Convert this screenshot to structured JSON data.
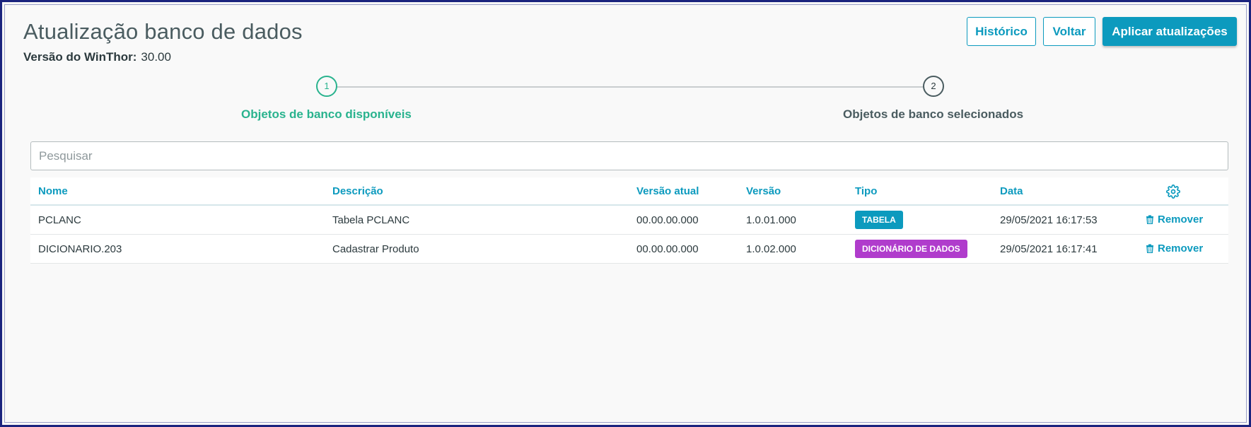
{
  "header": {
    "title": "Atualização banco de dados",
    "version_label": "Versão do WinThor:",
    "version_value": "30.00"
  },
  "toolbar": {
    "historico_label": "Histórico",
    "voltar_label": "Voltar",
    "aplicar_label": "Aplicar atualizações"
  },
  "stepper": {
    "steps": [
      {
        "number": "1",
        "label": "Objetos de banco disponíveis",
        "active": true
      },
      {
        "number": "2",
        "label": "Objetos de banco selecionados",
        "active": false
      }
    ]
  },
  "search": {
    "placeholder": "Pesquisar",
    "value": ""
  },
  "table": {
    "columns": {
      "nome": "Nome",
      "descricao": "Descrição",
      "versao_atual": "Versão atual",
      "versao": "Versão",
      "tipo": "Tipo",
      "data": "Data"
    },
    "settings_icon": "gear-icon",
    "rows": [
      {
        "nome": "PCLANC",
        "descricao": "Tabela PCLANC",
        "versao_atual": "00.00.00.000",
        "versao": "1.0.01.000",
        "tipo": "TABELA",
        "tipo_color": "#0c9abe",
        "data": "29/05/2021 16:17:53",
        "acao": "Remover",
        "acao_icon": "trash-icon"
      },
      {
        "nome": "DICIONARIO.203",
        "descricao": "Cadastrar Produto",
        "versao_atual": "00.00.00.000",
        "versao": "1.0.02.000",
        "tipo": "DICIONÁRIO DE DADOS",
        "tipo_color": "#b03ccc",
        "data": "29/05/2021 16:17:41",
        "acao": "Remover",
        "acao_icon": "trash-icon"
      }
    ]
  },
  "colors": {
    "primary": "#0c9abe",
    "step_active": "#29b38e",
    "text": "#2c3a3e",
    "frame_border": "#1a237e"
  }
}
